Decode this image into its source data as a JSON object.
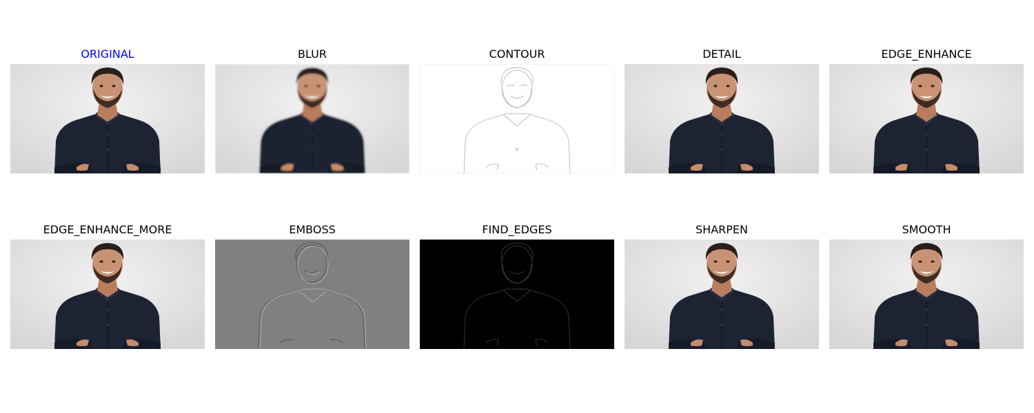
{
  "figure": {
    "title_colors": {
      "highlight": "#0000ff",
      "normal": "#000000"
    },
    "panels": [
      {
        "title": "ORIGINAL",
        "highlighted": true,
        "image": "portrait-original"
      },
      {
        "title": "BLUR",
        "highlighted": false,
        "image": "portrait-blur"
      },
      {
        "title": "CONTOUR",
        "highlighted": false,
        "image": "portrait-contour"
      },
      {
        "title": "DETAIL",
        "highlighted": false,
        "image": "portrait-detail"
      },
      {
        "title": "EDGE_ENHANCE",
        "highlighted": false,
        "image": "portrait-edge-enhance"
      },
      {
        "title": "EDGE_ENHANCE_MORE",
        "highlighted": false,
        "image": "portrait-edge-enhance-more"
      },
      {
        "title": "EMBOSS",
        "highlighted": false,
        "image": "portrait-emboss"
      },
      {
        "title": "FIND_EDGES",
        "highlighted": false,
        "image": "portrait-find-edges"
      },
      {
        "title": "SHARPEN",
        "highlighted": false,
        "image": "portrait-sharpen"
      },
      {
        "title": "SMOOTH",
        "highlighted": false,
        "image": "portrait-smooth"
      }
    ]
  }
}
